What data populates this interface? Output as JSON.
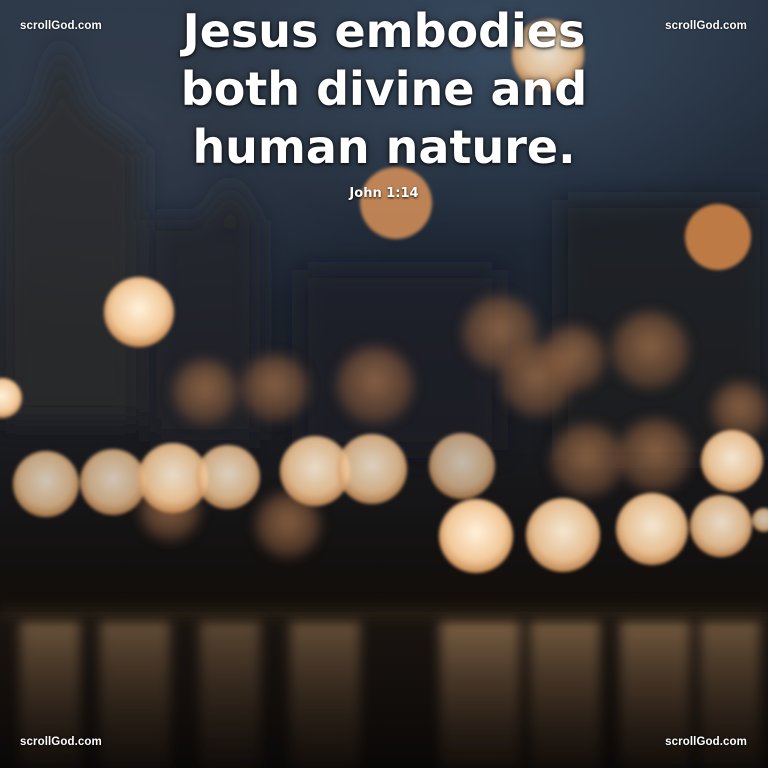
{
  "image": {
    "description_colors": {
      "sky_top": "#2a3646",
      "ground": "#0e0b09",
      "bokeh_warm": "#f3cfa2",
      "bokeh_amber": "#d98a4a",
      "text": "#ffffff"
    }
  },
  "quote": {
    "lines": [
      "Jesus embodies",
      "both divine and",
      "human nature."
    ]
  },
  "reference": "John 1:14",
  "watermarks": {
    "top_left": "scrollGod.com",
    "top_right": "scrollGod.com",
    "bottom_left": "scrollGod.com",
    "bottom_right": "scrollGod.com"
  }
}
